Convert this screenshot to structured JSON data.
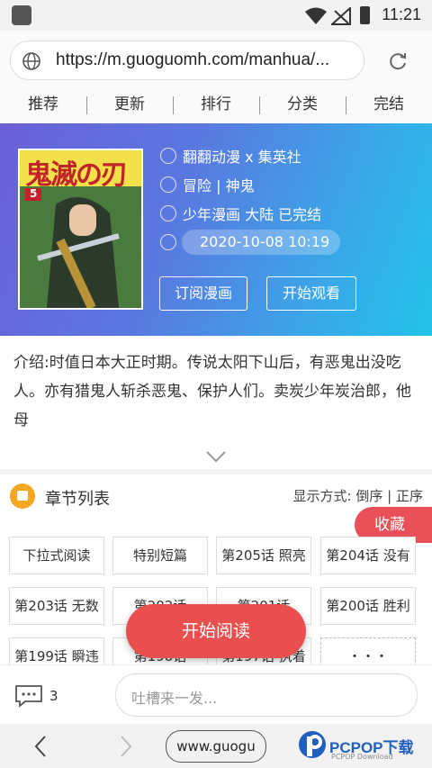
{
  "status": {
    "time": "11:21"
  },
  "urlbar": {
    "url": "https://m.guoguomh.com/manhua/..."
  },
  "nav": {
    "tabs": [
      "推荐",
      "更新",
      "排行",
      "分类",
      "完结"
    ]
  },
  "comic": {
    "author": "翻翻动漫 x 集英社",
    "genre": "冒险 | 神鬼",
    "tags": "少年漫画 大陆 已完结",
    "updated": "2020-10-08 10:19",
    "subscribe_label": "订阅漫画",
    "start_label": "开始观看",
    "cover_title": "鬼滅の刃",
    "cover_volume": "5"
  },
  "intro": {
    "text": "介绍:时值日本大正时期。传说太阳下山后，有恶鬼出没吃人。亦有猎鬼人斩杀恶鬼、保护人们。卖炭少年炭治郎，他母"
  },
  "chapters": {
    "title": "章节列表",
    "sort_prefix": "显示方式: ",
    "sort_desc": "倒序",
    "sort_sep": " | ",
    "sort_asc": "正序",
    "favorite_label": "收藏",
    "items": [
      "下拉式阅读",
      "特别短篇",
      "第205话 照亮",
      "第204话 没有",
      "第203话 无数",
      "第202话",
      "第201话",
      "第200话 胜利",
      "第199话 瞬违",
      "第198话",
      "第197话 执着",
      "・・・"
    ],
    "start_reading_label": "开始阅读"
  },
  "comment": {
    "count": "3",
    "placeholder": "吐槽来一发..."
  },
  "browser": {
    "short_url": "www.guogu"
  },
  "watermark": {
    "brand": "PCPOP下载",
    "sub": "PCPOP Download"
  }
}
